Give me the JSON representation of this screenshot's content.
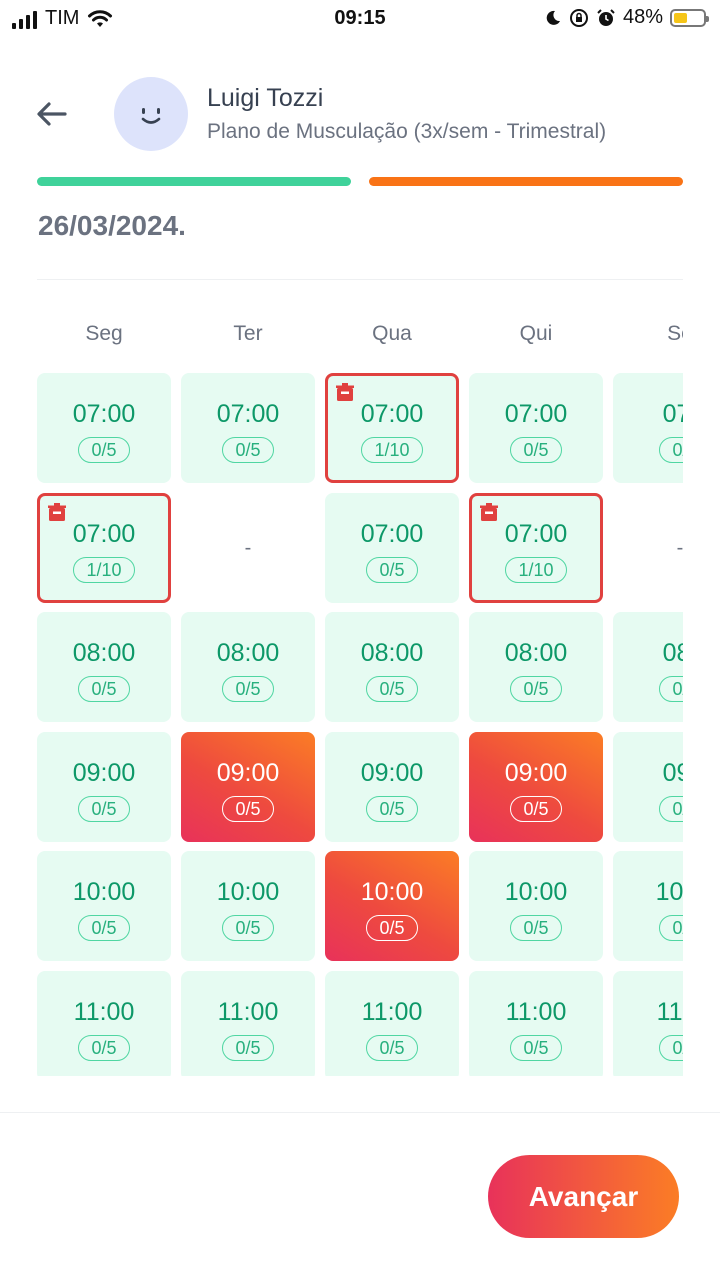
{
  "status_bar": {
    "carrier": "TIM",
    "time": "09:15",
    "battery": "48%",
    "battery_level": 0.48
  },
  "header": {
    "user_name": "Luigi Tozzi",
    "plan": "Plano de Musculação (3x/sem - Trimestral)",
    "date_fragment": "26/03/2024."
  },
  "days": [
    "Seg",
    "Ter",
    "Qua",
    "Qui",
    "Se"
  ],
  "slots": [
    [
      {
        "time": "07:00",
        "cap": "0/5",
        "state": "available"
      },
      {
        "time": "07:00",
        "cap": "0/5",
        "state": "available"
      },
      {
        "time": "07:00",
        "cap": "1/10",
        "state": "booked"
      },
      {
        "time": "07:00",
        "cap": "0/5",
        "state": "available"
      },
      {
        "time": "07:",
        "cap": "0/",
        "state": "available"
      }
    ],
    [
      {
        "time": "07:00",
        "cap": "1/10",
        "state": "booked"
      },
      {
        "time": "-",
        "cap": "",
        "state": "empty"
      },
      {
        "time": "07:00",
        "cap": "0/5",
        "state": "available"
      },
      {
        "time": "07:00",
        "cap": "1/10",
        "state": "booked"
      },
      {
        "time": "-",
        "cap": "",
        "state": "empty"
      }
    ],
    [
      {
        "time": "08:00",
        "cap": "0/5",
        "state": "available"
      },
      {
        "time": "08:00",
        "cap": "0/5",
        "state": "available"
      },
      {
        "time": "08:00",
        "cap": "0/5",
        "state": "available"
      },
      {
        "time": "08:00",
        "cap": "0/5",
        "state": "available"
      },
      {
        "time": "08:",
        "cap": "0/",
        "state": "available"
      }
    ],
    [
      {
        "time": "09:00",
        "cap": "0/5",
        "state": "available"
      },
      {
        "time": "09:00",
        "cap": "0/5",
        "state": "selected"
      },
      {
        "time": "09:00",
        "cap": "0/5",
        "state": "available"
      },
      {
        "time": "09:00",
        "cap": "0/5",
        "state": "selected"
      },
      {
        "time": "09:",
        "cap": "0/",
        "state": "available"
      }
    ],
    [
      {
        "time": "10:00",
        "cap": "0/5",
        "state": "available"
      },
      {
        "time": "10:00",
        "cap": "0/5",
        "state": "available"
      },
      {
        "time": "10:00",
        "cap": "0/5",
        "state": "selected"
      },
      {
        "time": "10:00",
        "cap": "0/5",
        "state": "available"
      },
      {
        "time": "10:0",
        "cap": "0/",
        "state": "available"
      }
    ],
    [
      {
        "time": "11:00",
        "cap": "0/5",
        "state": "available"
      },
      {
        "time": "11:00",
        "cap": "0/5",
        "state": "available"
      },
      {
        "time": "11:00",
        "cap": "0/5",
        "state": "available"
      },
      {
        "time": "11:00",
        "cap": "0/5",
        "state": "available"
      },
      {
        "time": "11:0",
        "cap": "0/",
        "state": "available"
      }
    ]
  ],
  "footer": {
    "next_label": "Avançar"
  },
  "colors": {
    "progress_done": "#3fd29a",
    "progress_current": "#f97316",
    "slot_bg": "#e6fbf2",
    "slot_text": "#0d9868",
    "booked_border": "#e0413f",
    "gradient_start": "#e8325a",
    "gradient_end": "#fb7d25"
  },
  "progress": [
    {
      "name": "step-1",
      "value": 1.0
    },
    {
      "name": "step-2",
      "value": 1.0
    }
  ]
}
